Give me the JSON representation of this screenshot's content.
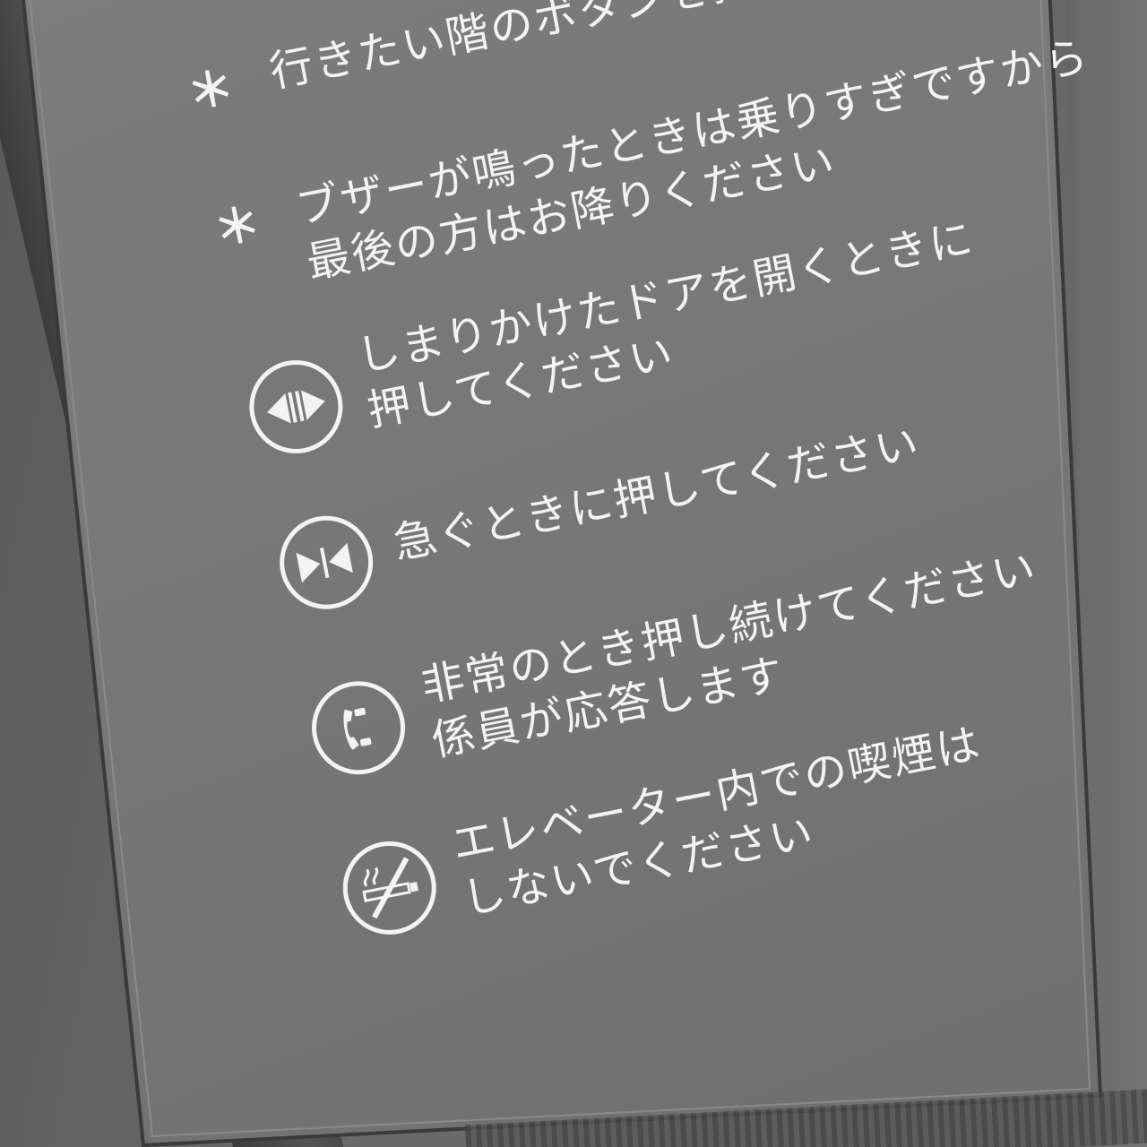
{
  "instructions": {
    "floor_button": {
      "marker": "＊",
      "lines": [
        "行きたい階のボタンを押してください"
      ]
    },
    "buzzer": {
      "marker": "＊",
      "lines": [
        "ブザーが鳴ったときは乗りすぎですから",
        "最後の方はお降りください"
      ]
    },
    "door_open": {
      "icon": "door-open-icon",
      "lines": [
        "しまりかけたドアを開くときに",
        "押してください"
      ]
    },
    "door_close": {
      "icon": "door-close-icon",
      "lines": [
        "急ぐときに押してください"
      ]
    },
    "emergency": {
      "icon": "phone-icon",
      "lines": [
        "非常のとき押し続けてください",
        "係員が応答します"
      ]
    },
    "no_smoking": {
      "icon": "no-smoking-icon",
      "lines": [
        "エレベーター内での喫煙は",
        "しないでください"
      ]
    }
  },
  "colors": {
    "panel": "#777777",
    "text": "#f3f3f3"
  }
}
